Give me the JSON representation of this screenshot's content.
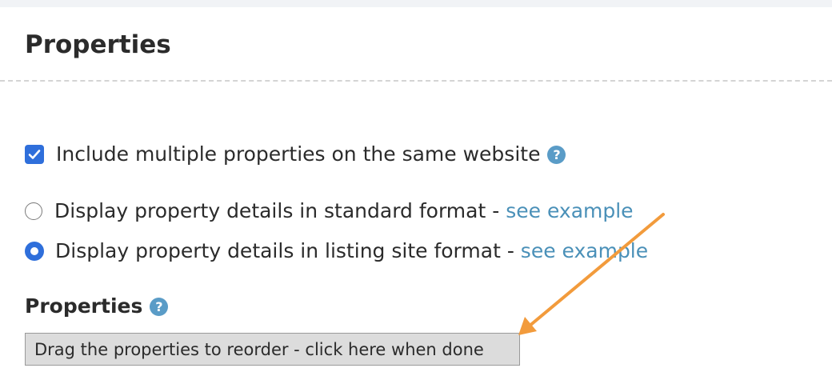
{
  "header": {
    "title": "Properties"
  },
  "options": {
    "multiple": {
      "label": "Include multiple properties on the same website",
      "checked": true
    },
    "standard": {
      "label": "Display property details in standard format",
      "separator": " - ",
      "link": "see example",
      "selected": false
    },
    "listing": {
      "label": "Display property details in listing site format",
      "separator": " - ",
      "link": "see example",
      "selected": true
    }
  },
  "properties_section": {
    "heading": "Properties",
    "reorder_button": "Drag the properties to reorder - click here when done"
  },
  "icons": {
    "help": "question-mark-circle-icon",
    "help_glyph": "?"
  },
  "colors": {
    "accent": "#2f6fdb",
    "link": "#4a90b8",
    "help": "#5a9cc7",
    "annotation_arrow": "#f29b3c"
  }
}
